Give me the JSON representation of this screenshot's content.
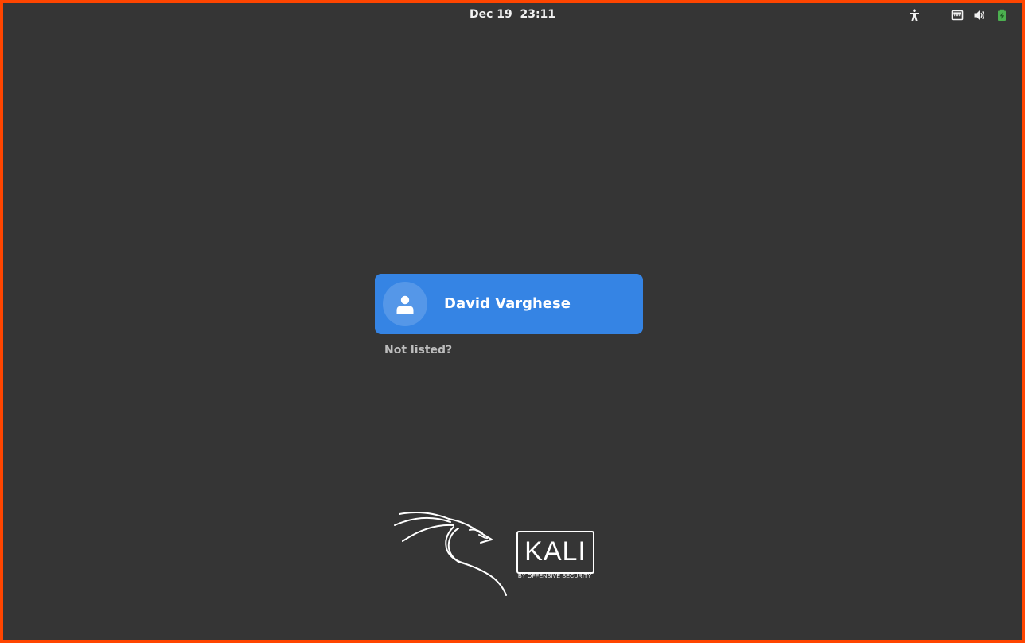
{
  "top_bar": {
    "clock": "Dec 19  23:11",
    "icons": [
      "accessibility-icon",
      "network-wired-icon",
      "volume-icon",
      "battery-icon"
    ]
  },
  "login": {
    "user": {
      "name": "David Varghese",
      "avatar_icon": "user-avatar-icon"
    },
    "not_listed": "Not listed?"
  },
  "branding": {
    "logo_icon": "kali-dragon-icon",
    "wordmark": "KALI",
    "tagline": "BY OFFENSIVE SECURITY"
  },
  "colors": {
    "background": "#353535",
    "frame": "#ff4500",
    "accent": "#3584e4",
    "battery": "#4caf50"
  }
}
